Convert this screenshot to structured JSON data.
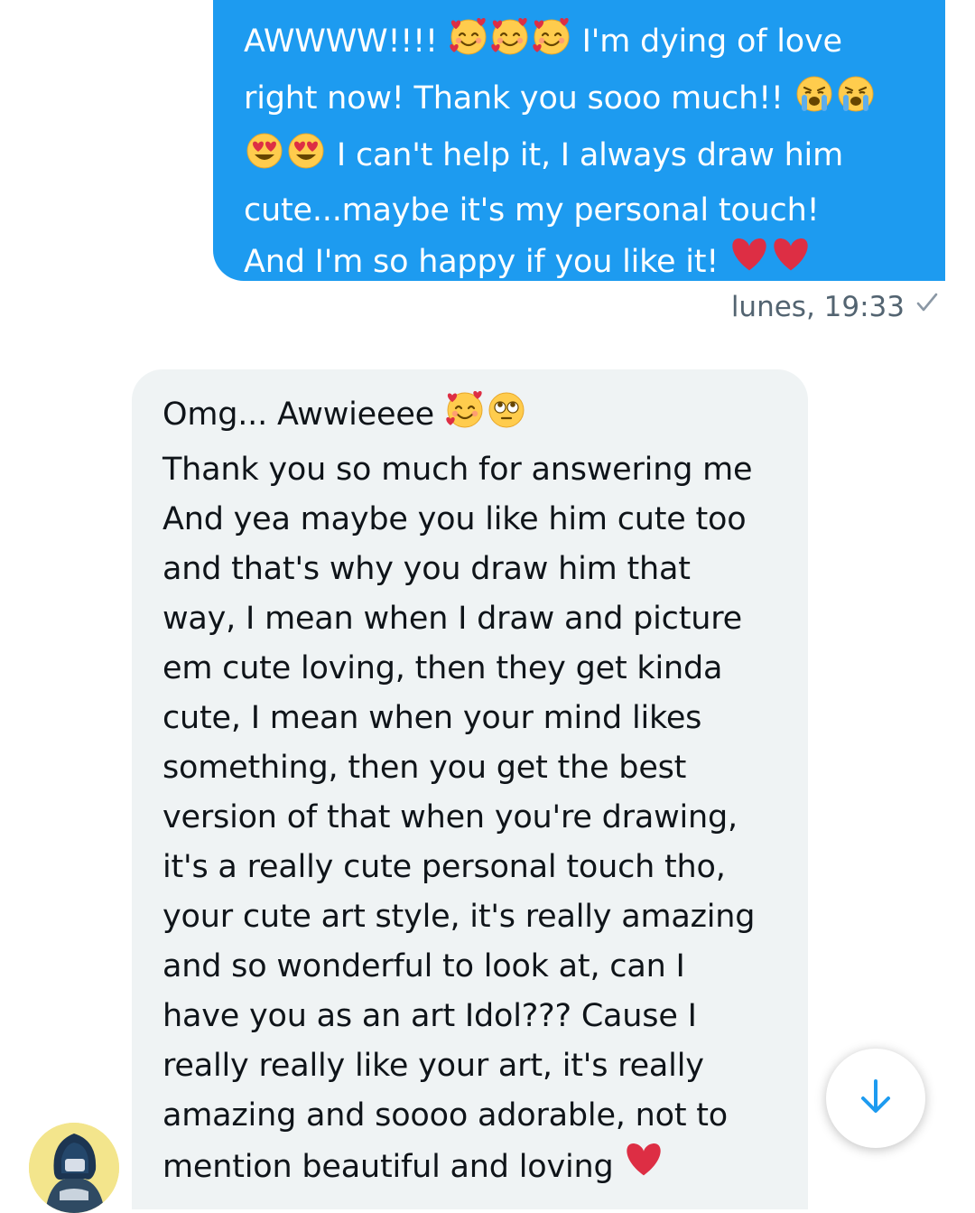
{
  "sent_message": {
    "lines": [
      {
        "before": "AWWWW!!!! ",
        "emojis": [
          "smiling-face-with-hearts-icon",
          "smiling-face-with-hearts-icon",
          "smiling-face-with-hearts-icon"
        ],
        "after": " I'm dying of love"
      },
      {
        "before": "right now! Thank you sooo much!! ",
        "emojis": [
          "loudly-crying-face-icon",
          "loudly-crying-face-icon"
        ],
        "after": ""
      },
      {
        "before": "",
        "emojis": [
          "heart-eyes-icon",
          "heart-eyes-icon"
        ],
        "after": " I can't help it, I always draw him"
      },
      {
        "before": "cute...maybe it's my personal touch!",
        "emojis": [],
        "after": ""
      },
      {
        "before": "And I'm so happy if you like it! ",
        "emojis": [
          "red-heart-icon",
          "red-heart-icon"
        ],
        "after": ""
      }
    ],
    "timestamp": "lunes, 19:33",
    "status_icon": "sent-check-icon"
  },
  "received_message": {
    "lines": [
      {
        "before": "Omg... Awwieeee ",
        "emojis": [
          "smiling-face-with-hearts-icon",
          "face-with-rolling-eyes-icon"
        ],
        "after": ""
      },
      {
        "before": "Thank you so much for answering me",
        "emojis": [],
        "after": ""
      },
      {
        "before": "And yea maybe you like him cute too",
        "emojis": [],
        "after": ""
      },
      {
        "before": "and that's why you draw him that",
        "emojis": [],
        "after": ""
      },
      {
        "before": "way, I mean when I draw and picture",
        "emojis": [],
        "after": ""
      },
      {
        "before": "em cute loving, then they get kinda",
        "emojis": [],
        "after": ""
      },
      {
        "before": "cute, I mean when your mind likes",
        "emojis": [],
        "after": ""
      },
      {
        "before": "something, then you get the best",
        "emojis": [],
        "after": ""
      },
      {
        "before": "version of that when you're drawing,",
        "emojis": [],
        "after": ""
      },
      {
        "before": "it's a really cute personal touch tho,",
        "emojis": [],
        "after": ""
      },
      {
        "before": "your cute art style, it's really amazing",
        "emojis": [],
        "after": ""
      },
      {
        "before": "and so wonderful to look at, can I",
        "emojis": [],
        "after": ""
      },
      {
        "before": "have you as an art Idol??? Cause I",
        "emojis": [],
        "after": ""
      },
      {
        "before": "really really like your art, it's really",
        "emojis": [],
        "after": ""
      },
      {
        "before": "amazing and soooo adorable, not to",
        "emojis": [],
        "after": ""
      },
      {
        "before": "mention beautiful and loving ",
        "emojis": [
          "red-heart-icon"
        ],
        "after": ""
      }
    ]
  },
  "sender_avatar": {
    "icon": "user-avatar"
  },
  "scroll_button": {
    "icon": "arrow-down-icon"
  },
  "colors": {
    "accent": "#1d9bf0",
    "received_bg": "#eff3f4",
    "meta_text": "#536471",
    "text": "#0f1419"
  }
}
